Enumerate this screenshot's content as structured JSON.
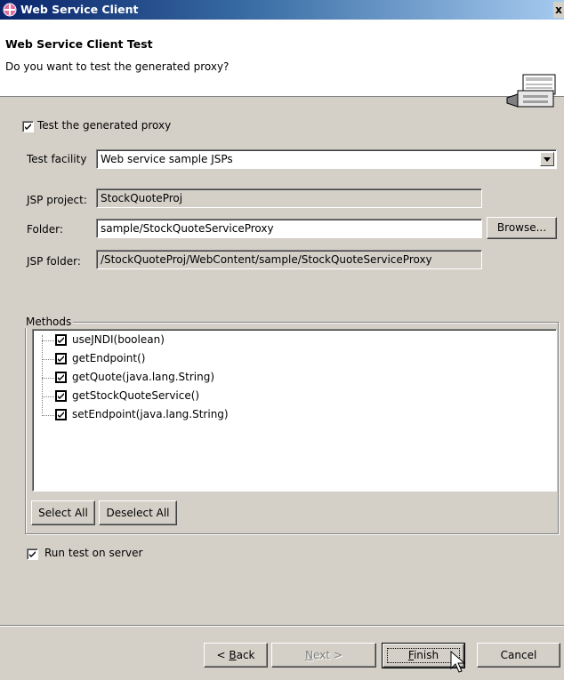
{
  "window": {
    "title": "Web Service Client",
    "close_glyph": "x",
    "icon": "eclipse-wizard-icon"
  },
  "banner": {
    "heading": "Web Service Client Test",
    "description": "Do you want to test the generated proxy?",
    "icon": "wizard-banner-icon"
  },
  "test_proxy": {
    "label": "Test the generated proxy",
    "checked": true
  },
  "test_facility": {
    "label": "Test facility",
    "value": "Web service sample JSPs"
  },
  "jsp_project": {
    "label": "JSP project:",
    "value": "StockQuoteProj"
  },
  "folder": {
    "label": "Folder:",
    "value": "sample/StockQuoteServiceProxy",
    "browse_label": "Browse..."
  },
  "jsp_folder": {
    "label": "JSP folder:",
    "value": "/StockQuoteProj/WebContent/sample/StockQuoteServiceProxy"
  },
  "methods": {
    "legend": "Methods",
    "items": [
      {
        "label": "useJNDI(boolean)",
        "checked": true
      },
      {
        "label": "getEndpoint()",
        "checked": true
      },
      {
        "label": "getQuote(java.lang.String)",
        "checked": true
      },
      {
        "label": "getStockQuoteService()",
        "checked": true
      },
      {
        "label": "setEndpoint(java.lang.String)",
        "checked": true
      }
    ],
    "select_all_label": "Select All",
    "deselect_all_label": "Deselect All"
  },
  "run_on_server": {
    "label": "Run test on server",
    "checked": true
  },
  "footer": {
    "back_prefix": "< ",
    "back_mnemonic": "B",
    "back_rest": "ack",
    "next_mnemonic": "N",
    "next_rest": "ext >",
    "finish_mnemonic": "F",
    "finish_rest": "inish",
    "cancel_label": "Cancel"
  },
  "colors": {
    "dialog_bg": "#d4d0c8",
    "title_gradient_start": "#0a246a",
    "title_gradient_end": "#a6caf0"
  }
}
